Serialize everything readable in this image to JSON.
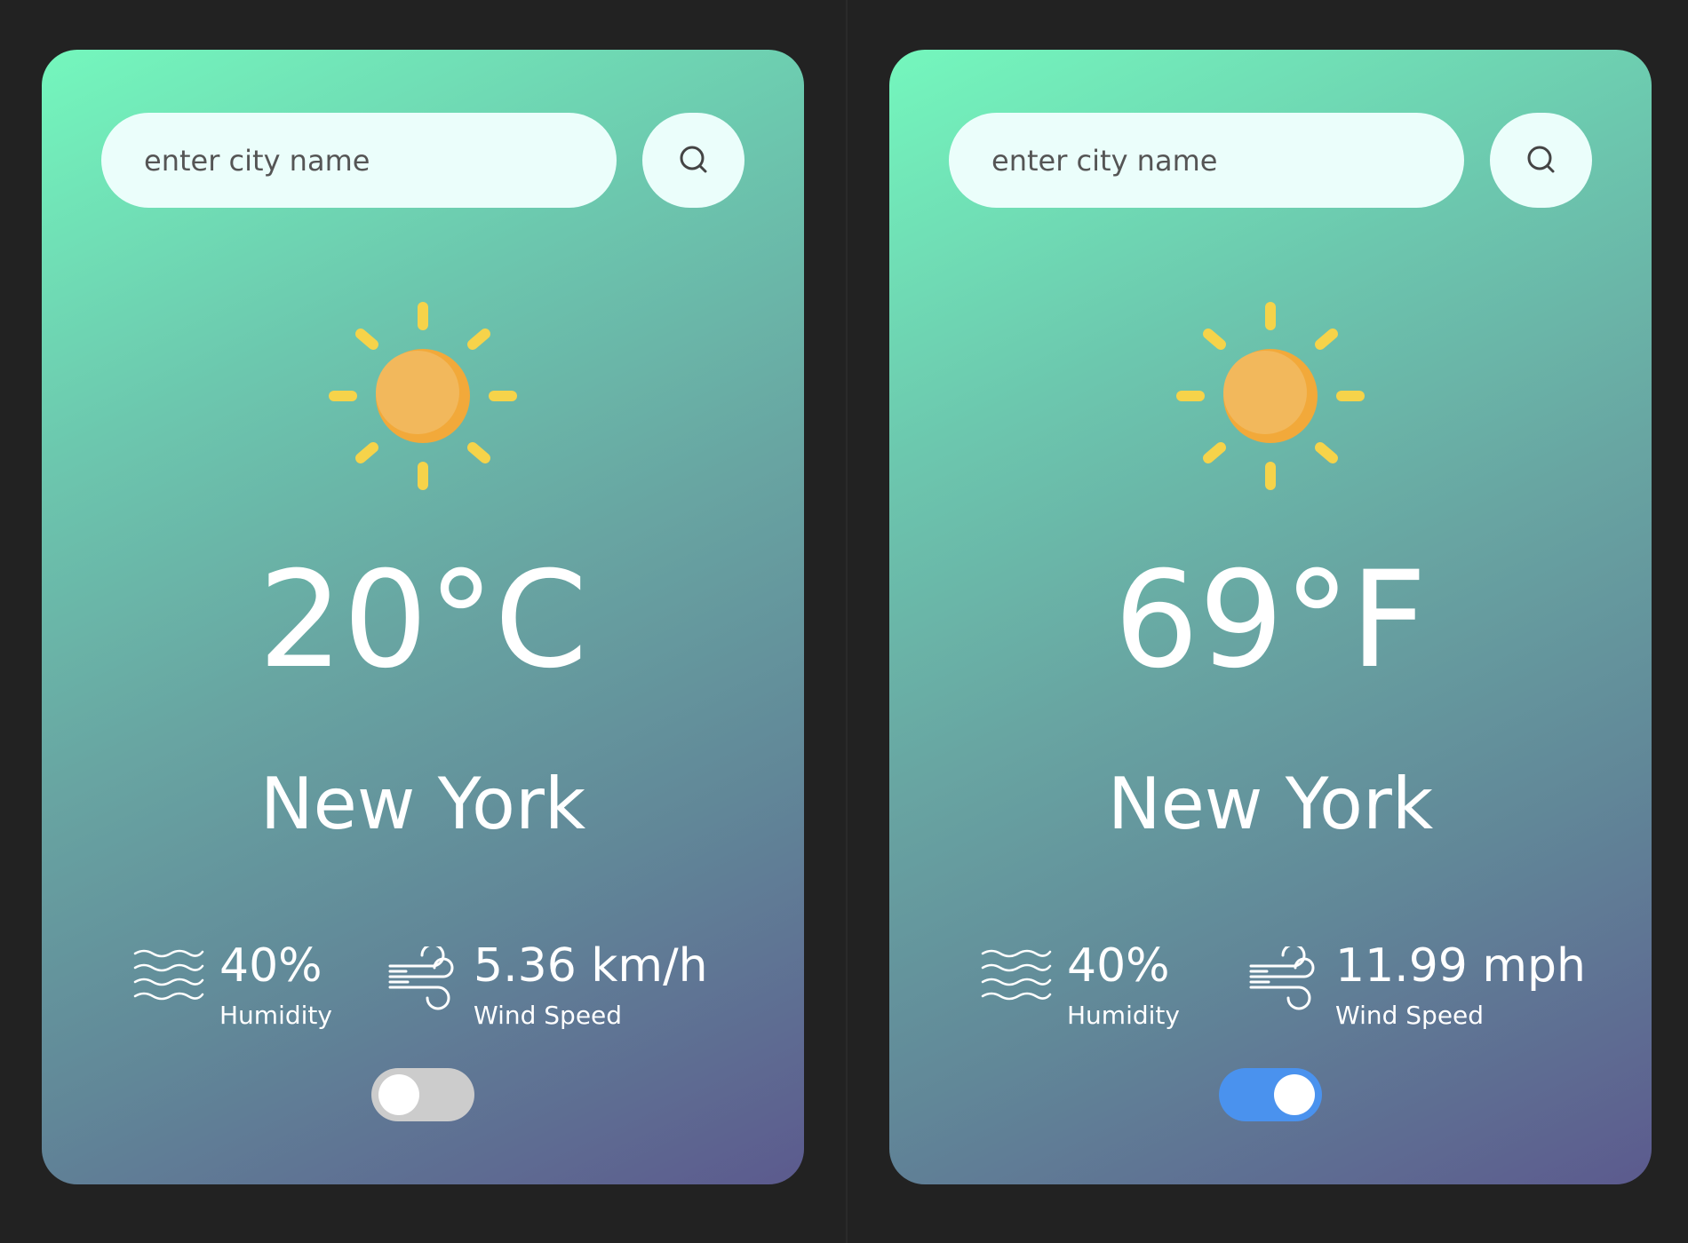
{
  "colors": {
    "page_background": "#222222",
    "card_gradient_start": "#74f7bd",
    "card_gradient_end": "#5c5a8e",
    "search_background": "#ebfefb",
    "toggle_on": "#4a92ee",
    "toggle_off": "#cccccc",
    "sun": "#f2b85c",
    "sun_rays": "#f6d34a"
  },
  "cards": [
    {
      "search": {
        "placeholder": "enter city name"
      },
      "search_icon": "search-icon",
      "weather_icon": "sun-icon",
      "temperature": "20°C",
      "city": "New York",
      "humidity": {
        "value": "40%",
        "label": "Humidity",
        "icon": "waves-icon"
      },
      "wind": {
        "value": "5.36 km/h",
        "label": "Wind Speed",
        "icon": "wind-icon"
      },
      "unit_toggle": {
        "on": false
      }
    },
    {
      "search": {
        "placeholder": "enter city name"
      },
      "search_icon": "search-icon",
      "weather_icon": "sun-icon",
      "temperature": "69°F",
      "city": "New York",
      "humidity": {
        "value": "40%",
        "label": "Humidity",
        "icon": "waves-icon"
      },
      "wind": {
        "value": "11.99 mph",
        "label": "Wind Speed",
        "icon": "wind-icon"
      },
      "unit_toggle": {
        "on": true
      }
    }
  ]
}
